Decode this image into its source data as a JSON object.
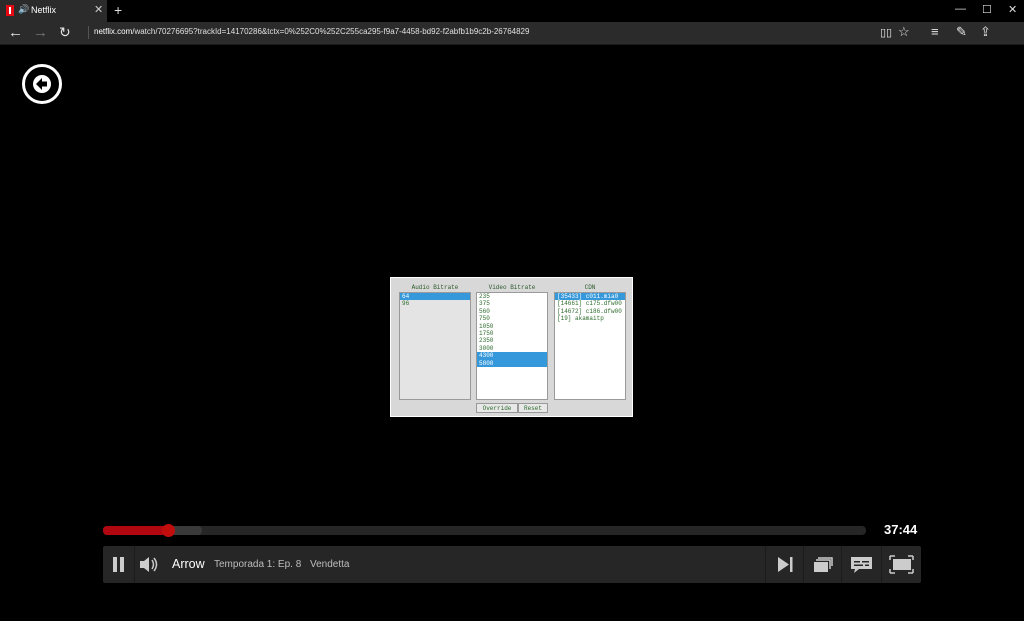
{
  "browser": {
    "tab_title": "Netflix",
    "tab_audio_icon": "speaker-icon",
    "new_tab_label": "+",
    "window_controls": [
      "minimize-icon",
      "maximize-icon",
      "close-icon"
    ],
    "url_domain": "netflix.com",
    "url_rest": "/watch/70276695?trackId=14170286&tctx=0%252C0%252C255ca295-f9a7-4458-bd92-f2abfb1b9c2b-26764829",
    "toolbar_icons": [
      "reading-view-icon",
      "favorite-star-icon",
      "hub-icon",
      "web-note-icon",
      "share-icon"
    ]
  },
  "debug_panel": {
    "audio": {
      "title": "Audio Bitrate",
      "options": [
        "64",
        "96"
      ],
      "selected": [
        0
      ]
    },
    "video": {
      "title": "Video Bitrate",
      "options": [
        "235",
        "375",
        "560",
        "750",
        "1050",
        "1750",
        "2350",
        "3000",
        "4300",
        "5800"
      ],
      "selected": [
        8,
        9
      ]
    },
    "cdn": {
      "title": "CDN",
      "options": [
        "[35433] c011.mia0",
        "[14661] c175.dfw00",
        "[14672] c186.dfw00",
        "[19] akamaitp"
      ],
      "selected": [
        0
      ]
    },
    "override_label": "Override",
    "reset_label": "Reset"
  },
  "player": {
    "time_remaining": "37:44",
    "progress_fraction": 0.085,
    "buffered_fraction": 0.13,
    "show_title": "Arrow",
    "episode_info": "Temporada 1: Ep. 8",
    "episode_title": "Vendetta",
    "accent": "#b00710"
  }
}
